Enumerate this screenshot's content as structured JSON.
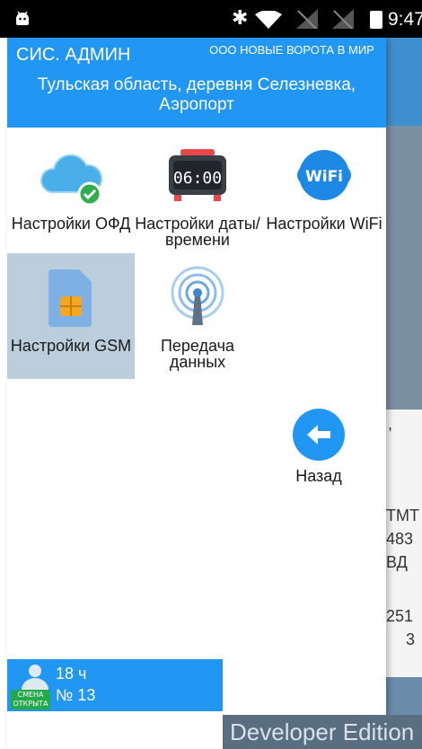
{
  "status_bar": {
    "time": "9:47",
    "icons": [
      "android-debug-icon",
      "bluetooth-icon",
      "wifi-icon",
      "no-signal-icon",
      "no-signal-icon",
      "battery-icon"
    ]
  },
  "header": {
    "role": "СИС. АДМИН",
    "organization": "ООО НОВЫЕ ВОРОТА В МИР",
    "address": "Тульская область, деревня Селезневка, Аэропорт",
    "color": "#2196f3"
  },
  "settings": [
    {
      "label": "Настройки ОФД",
      "icon": "cloud-check-icon",
      "selected": false
    },
    {
      "label": "Настройки даты/времени",
      "icon": "alarm-clock-icon",
      "selected": false
    },
    {
      "label": "Настройки WiFi",
      "icon": "wifi-badge-icon",
      "selected": false
    },
    {
      "label": "Настройки GSM",
      "icon": "sim-card-icon",
      "selected": true
    },
    {
      "label": "Передача данных",
      "icon": "antenna-icon",
      "selected": false
    }
  ],
  "clock_display": "06:00",
  "wifi_badge": "WiFi",
  "back": {
    "label": "Назад",
    "icon": "arrow-left-icon"
  },
  "shift": {
    "hours": "18 ч",
    "number": "№ 13",
    "badge": "СМЕНА ОТКРЫТА"
  },
  "background_screen": {
    "fragments": [
      ",",
      "ТМТ",
      "483",
      "ВД",
      "251",
      "3"
    ]
  },
  "watermark": "Developer Edition"
}
